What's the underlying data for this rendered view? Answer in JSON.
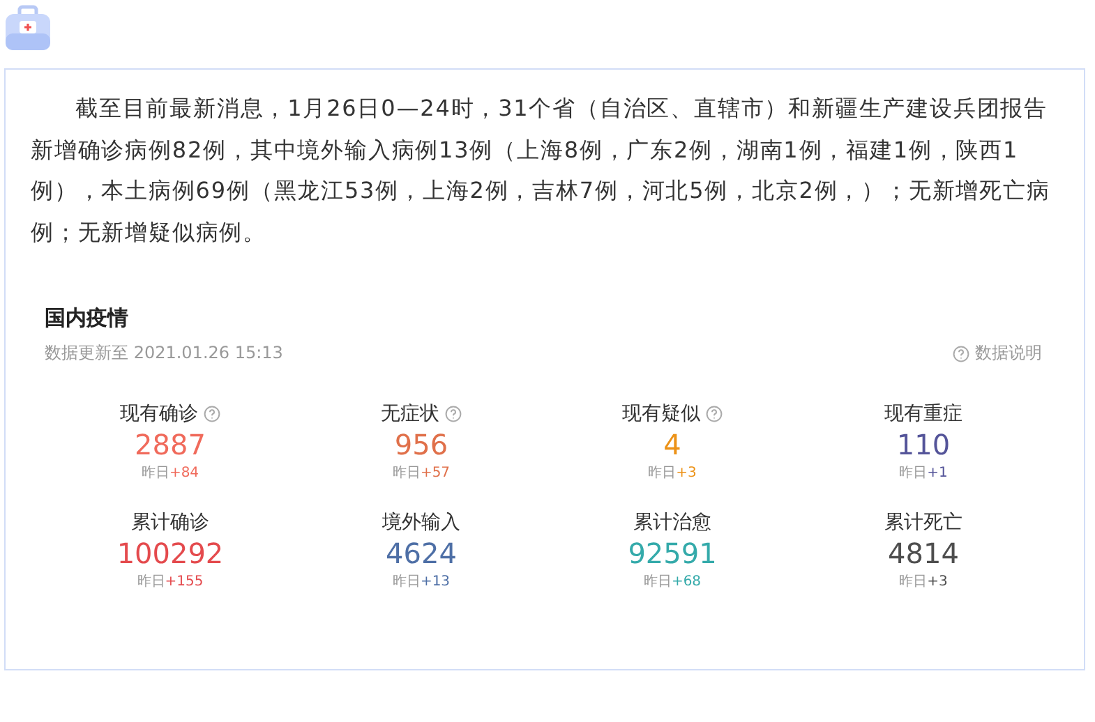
{
  "paragraph": "截至目前最新消息，1月26日0—24时，31个省（自治区、直辖市）和新疆生产建设兵团报告新增确诊病例82例，其中境外输入病例13例（上海8例，广东2例，湖南1例，福建1例，陕西1例），本土病例69例（黑龙江53例，上海2例，吉林7例，河北5例，北京2例，）；无新增死亡病例；无新增疑似病例。",
  "section": {
    "title": "国内疫情",
    "updated": "数据更新至 2021.01.26 15:13",
    "help_link": "数据说明",
    "stats": [
      {
        "label": "现有确诊",
        "help": true,
        "value": "2887",
        "prev_label": "昨日",
        "delta": "+84",
        "color": "#f06a5b"
      },
      {
        "label": "无症状",
        "help": true,
        "value": "956",
        "prev_label": "昨日",
        "delta": "+57",
        "color": "#e0704a"
      },
      {
        "label": "现有疑似",
        "help": true,
        "value": "4",
        "prev_label": "昨日",
        "delta": "+3",
        "color": "#ec9217"
      },
      {
        "label": "现有重症",
        "help": false,
        "value": "110",
        "prev_label": "昨日",
        "delta": "+1",
        "color": "#545499"
      },
      {
        "label": "累计确诊",
        "help": false,
        "value": "100292",
        "prev_label": "昨日",
        "delta": "+155",
        "color": "#e44a4d"
      },
      {
        "label": "境外输入",
        "help": false,
        "value": "4624",
        "prev_label": "昨日",
        "delta": "+13",
        "color": "#4e6fa6"
      },
      {
        "label": "累计治愈",
        "help": false,
        "value": "92591",
        "prev_label": "昨日",
        "delta": "+68",
        "color": "#34aaaa"
      },
      {
        "label": "累计死亡",
        "help": false,
        "value": "4814",
        "prev_label": "昨日",
        "delta": "+3",
        "color": "#4e4e4e"
      }
    ]
  }
}
